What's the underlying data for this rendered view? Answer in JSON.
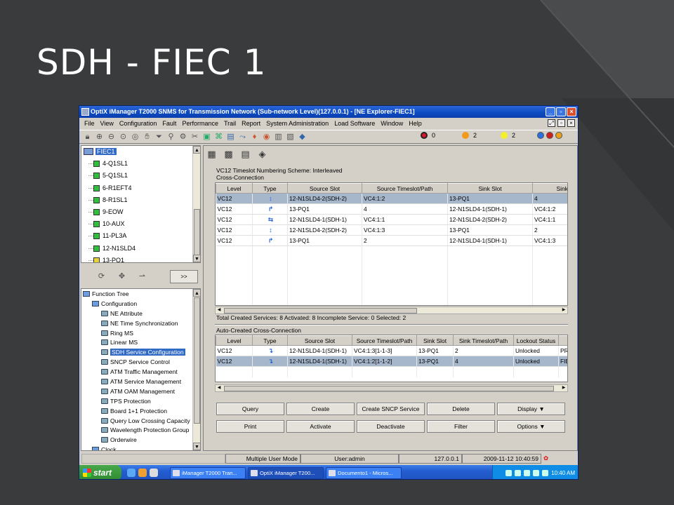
{
  "slide": {
    "title": "SDH - FIEC 1"
  },
  "window": {
    "title": "OptiX iManager T2000 SNMS for Transmission Network (Sub-network Level)(127.0.0.1) - [NE Explorer-FIEC1]",
    "controls": [
      "_",
      "▫",
      "×"
    ]
  },
  "menu": [
    "File",
    "View",
    "Configuration",
    "Fault",
    "Performance",
    "Trail",
    "Report",
    "System Administration",
    "Load Software",
    "Window",
    "Help"
  ],
  "alarms": {
    "critical": "0",
    "major": "2",
    "minor": "2"
  },
  "ne_tree": {
    "root": "FIEC1",
    "boards": [
      "4-Q1SL1",
      "5-Q1SL1",
      "6-R1EFT4",
      "8-R1SL1",
      "9-EOW",
      "10-AUX",
      "11-PL3A",
      "12-N1SLD4",
      "13-PQ1"
    ],
    "more_button": ">>"
  },
  "function_tree": {
    "items": [
      {
        "label": "Function Tree",
        "level": 0
      },
      {
        "label": "Configuration",
        "level": 1
      },
      {
        "label": "NE Attribute",
        "level": 2
      },
      {
        "label": "NE Time Synchronization",
        "level": 2
      },
      {
        "label": "Ring MS",
        "level": 2
      },
      {
        "label": "Linear MS",
        "level": 2
      },
      {
        "label": "SDH Service Configuration",
        "level": 2,
        "selected": true
      },
      {
        "label": "SNCP Service Control",
        "level": 2
      },
      {
        "label": "ATM Traffic Management",
        "level": 2
      },
      {
        "label": "ATM Service Management",
        "level": 2
      },
      {
        "label": "ATM OAM Management",
        "level": 2
      },
      {
        "label": "TPS Protection",
        "level": 2
      },
      {
        "label": "Board 1+1 Protection",
        "level": 2
      },
      {
        "label": "Query Low Crossing Capacity",
        "level": 2
      },
      {
        "label": "Wavelength Protection Group",
        "level": 2
      },
      {
        "label": "Orderwire",
        "level": 2
      },
      {
        "label": "Clock",
        "level": 1
      }
    ]
  },
  "main": {
    "scheme": "VC12 Timeslot Numbering Scheme: Interleaved",
    "cross_connection": {
      "title": "Cross-Connection",
      "headers": [
        "Level",
        "Type",
        "Source Slot",
        "Source Timeslot/Path",
        "Sink Slot",
        "Sink Times"
      ],
      "rows": [
        [
          "VC12",
          "↕",
          "12-N1SLD4-2(SDH-2)",
          "VC4:1:2",
          "13-PQ1",
          "4"
        ],
        [
          "VC12",
          "↱",
          "13-PQ1",
          "4",
          "12-N1SLD4-1(SDH-1)",
          "VC4:1:2"
        ],
        [
          "VC12",
          "⇆",
          "12-N1SLD4-1(SDH-1)",
          "VC4:1:1",
          "12-N1SLD4-2(SDH-2)",
          "VC4:1:1"
        ],
        [
          "VC12",
          "↕",
          "12-N1SLD4-2(SDH-2)",
          "VC4:1:3",
          "13-PQ1",
          "2"
        ],
        [
          "VC12",
          "↱",
          "13-PQ1",
          "2",
          "12-N1SLD4-1(SDH-1)",
          "VC4:1:3"
        ]
      ]
    },
    "totals": "Total Created Services: 8   Activated: 8   Incomplete Service: 0   Selected: 2",
    "auto_cross_connection": {
      "title": "Auto-Created Cross-Connection",
      "headers": [
        "Level",
        "Type",
        "Source Slot",
        "Source Timeslot/Path",
        "Sink Slot",
        "Sink Timeslot/Path",
        "Lockout Status",
        "Tr"
      ],
      "rows": [
        [
          "VC12",
          "↴",
          "12-N1SLD4-1(SDH-1)",
          "VC4:1:3[1-1-3]",
          "13-PQ1",
          "2",
          "Unlocked",
          "PR"
        ],
        [
          "VC12",
          "↴",
          "12-N1SLD4-1(SDH-1)",
          "VC4:1:2[1-1-2]",
          "13-PQ1",
          "4",
          "Unlocked",
          "FIE"
        ]
      ]
    },
    "buttons_row1": [
      "Query",
      "Create",
      "Create SNCP Service",
      "Delete",
      "Display ▼"
    ],
    "buttons_row2": [
      "Print",
      "Activate",
      "Deactivate",
      "Filter",
      "Options ▼"
    ]
  },
  "status_bar": {
    "mode": "Multiple User Mode",
    "user": "User:admin",
    "ip": "127.0.0.1",
    "datetime": "2009-11-12 10:40:59"
  },
  "taskbar": {
    "start": "start",
    "tasks": [
      "iManager T2000 Tran...",
      "OptiX iManager T200...",
      "Documento1 - Micros..."
    ],
    "clock": "10:40 AM"
  }
}
